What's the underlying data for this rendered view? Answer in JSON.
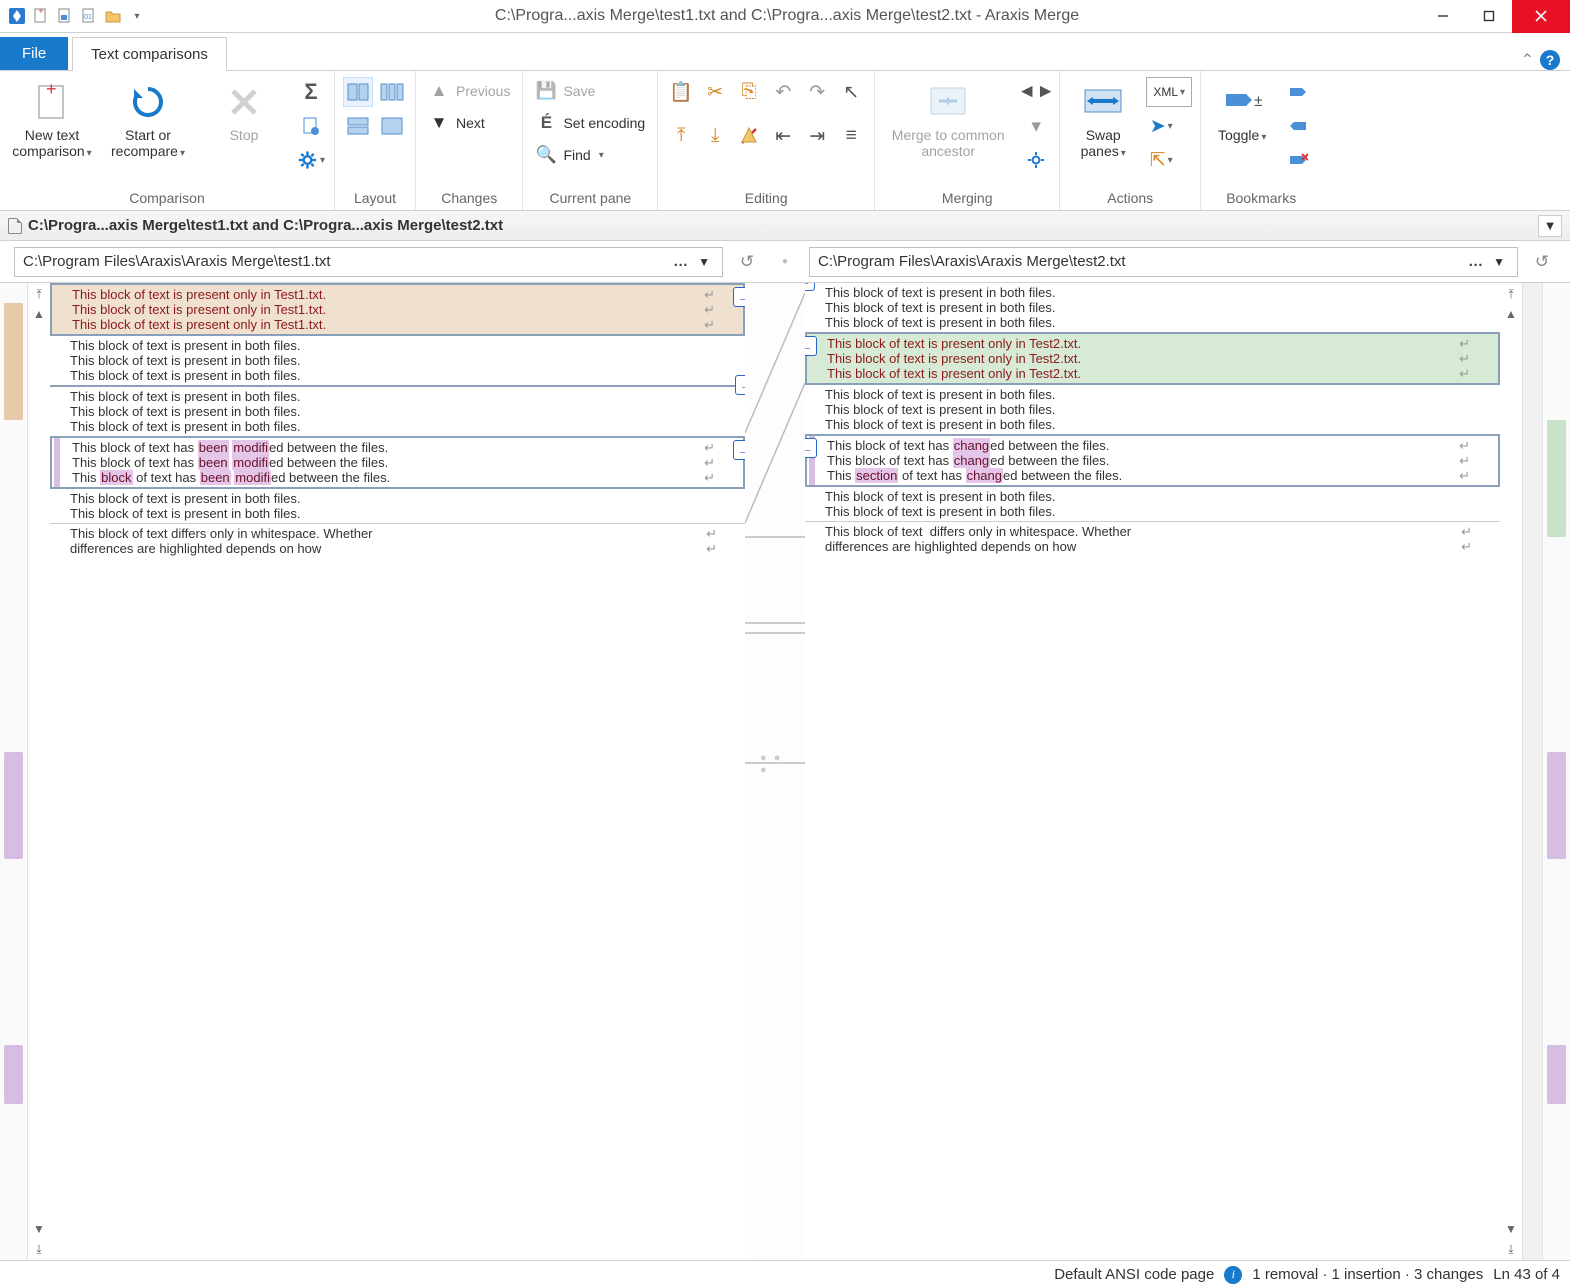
{
  "window": {
    "title": "C:\\Progra...axis Merge\\test1.txt and C:\\Progra...axis Merge\\test2.txt - Araxis Merge"
  },
  "tabs": {
    "file": "File",
    "textcomp": "Text comparisons"
  },
  "ribbon": {
    "comparison": {
      "label": "Comparison",
      "newtext": "New text\ncomparison",
      "start": "Start or\nrecompare",
      "stop": "Stop"
    },
    "layout": {
      "label": "Layout"
    },
    "changes": {
      "label": "Changes",
      "previous": "Previous",
      "next": "Next"
    },
    "currentpane": {
      "label": "Current pane",
      "save": "Save",
      "setenc": "Set encoding",
      "find": "Find"
    },
    "editing": {
      "label": "Editing"
    },
    "merging": {
      "label": "Merging",
      "mca": "Merge to common\nancestor"
    },
    "actions": {
      "label": "Actions",
      "swap": "Swap\npanes",
      "xml": "XML"
    },
    "bookmarks": {
      "label": "Bookmarks",
      "toggle": "Toggle"
    }
  },
  "doctab": "C:\\Progra...axis Merge\\test1.txt and C:\\Progra...axis Merge\\test2.txt",
  "paths": {
    "left": "C:\\Program Files\\Araxis\\Araxis Merge\\test1.txt",
    "right": "C:\\Program Files\\Araxis\\Araxis Merge\\test2.txt"
  },
  "content": {
    "left": {
      "removed": [
        "This block of text is present only in Test1.txt.",
        "This block of text is present only in Test1.txt.",
        "This block of text is present only in Test1.txt."
      ],
      "same1": [
        "This block of text is present in both files.",
        "This block of text is present in both files.",
        "This block of text is present in both files."
      ],
      "same2": [
        "This block of text is present in both files.",
        "This block of text is present in both files.",
        "This block of text is present in both files."
      ],
      "changed": [
        {
          "pre": "This block of text has ",
          "h": [
            "been",
            "modifi"
          ],
          "post": "ed between the files."
        },
        {
          "pre": "This block of text has ",
          "h": [
            "been",
            "modifi"
          ],
          "post": "ed between the files."
        },
        {
          "pre": "This ",
          "h0": "block",
          "mid": " of text has ",
          "h": [
            "been",
            "modifi"
          ],
          "post": "ed between the files."
        }
      ],
      "same3": [
        "This block of text is present in both files.",
        "This block of text is present in both files."
      ],
      "ws": [
        "This block of text differs only in whitespace. Whether",
        "differences are highlighted depends on how"
      ]
    },
    "right": {
      "same0": [
        "This block of text is present in both files.",
        "This block of text is present in both files.",
        "This block of text is present in both files."
      ],
      "added": [
        "This block of text is present only in Test2.txt.",
        "This block of text is present only in Test2.txt.",
        "This block of text is present only in Test2.txt."
      ],
      "same2": [
        "This block of text is present in both files.",
        "This block of text is present in both files.",
        "This block of text is present in both files."
      ],
      "changed": [
        {
          "pre": "This block of text has ",
          "h": [
            "chang"
          ],
          "post": "ed between the files."
        },
        {
          "pre": "This block of text has ",
          "h": [
            "chang"
          ],
          "post": "ed between the files."
        },
        {
          "pre": "This ",
          "h0": "section",
          "mid": " of text has ",
          "h": [
            "chang"
          ],
          "post": "ed between the files."
        }
      ],
      "same3": [
        "This block of text is present in both files.",
        "This block of text is present in both files."
      ],
      "ws": [
        "This block of text  differs only in whitespace. Whether",
        "differences are highlighted depends on how"
      ]
    }
  },
  "status": {
    "encoding": "Default ANSI code page",
    "diffs": "1 removal · 1 insertion · 3 changes",
    "pos": "Ln 43 of 4"
  }
}
